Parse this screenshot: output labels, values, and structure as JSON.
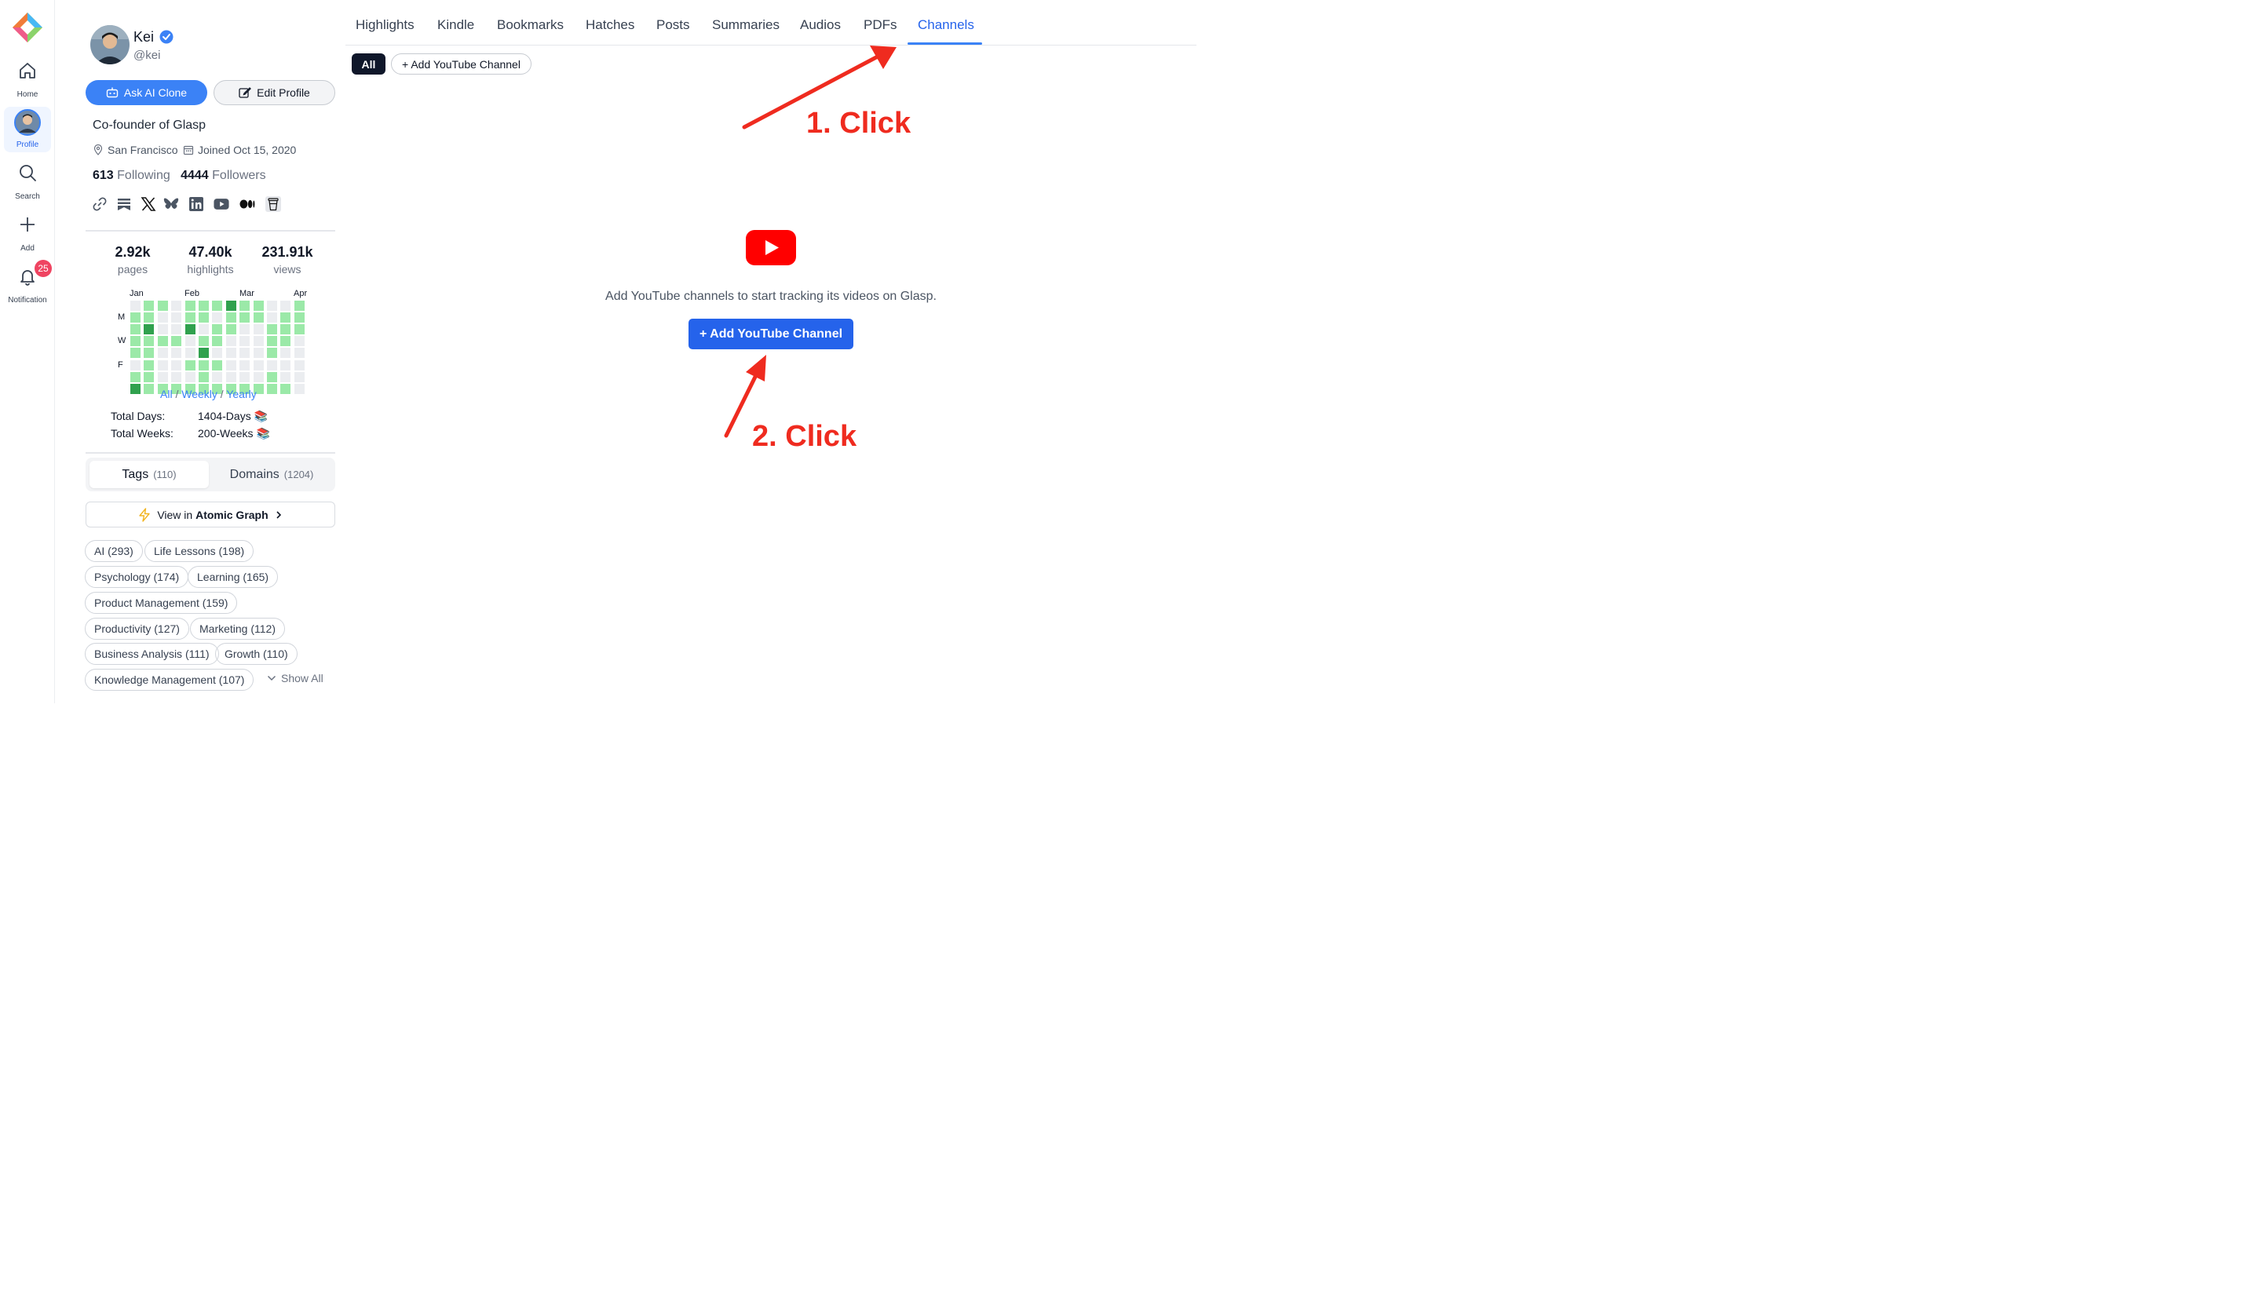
{
  "nav": {
    "items": [
      {
        "label": "Home",
        "icon": "home-icon"
      },
      {
        "label": "Profile",
        "icon": "avatar"
      },
      {
        "label": "Search",
        "icon": "search-icon"
      },
      {
        "label": "Add",
        "icon": "plus-icon"
      },
      {
        "label": "Notification",
        "icon": "bell-icon"
      }
    ],
    "notification_count": "25"
  },
  "profile": {
    "name": "Kei",
    "handle": "@kei",
    "ask_ai_label": "Ask AI Clone",
    "edit_label": "Edit Profile",
    "bio": "Co-founder of Glasp",
    "location": "San Francisco",
    "joined": "Joined Oct 15, 2020",
    "following_count": "613",
    "following_label": "Following",
    "followers_count": "4444",
    "followers_label": "Followers",
    "social_icons": [
      "link-icon",
      "bookmark-icon",
      "x-icon",
      "bluesky-icon",
      "linkedin-icon",
      "youtube-icon",
      "medium-icon",
      "coffee-icon"
    ]
  },
  "stats": [
    {
      "value": "2.92k",
      "label": "pages"
    },
    {
      "value": "47.40k",
      "label": "highlights"
    },
    {
      "value": "231.91k",
      "label": "views"
    }
  ],
  "heatmap": {
    "months": [
      "Jan",
      "Feb",
      "Mar",
      "Apr"
    ],
    "days": [
      "M",
      "W",
      "F"
    ],
    "colors": {
      "0": "#ebedf0",
      "1": "#9be9a8",
      "2": "#40c463",
      "3": "#30a14e"
    },
    "grid": [
      [
        0,
        1,
        1,
        0,
        1,
        1,
        1,
        3,
        1,
        1,
        0,
        0,
        1
      ],
      [
        1,
        1,
        0,
        0,
        1,
        1,
        0,
        1,
        1,
        1,
        0,
        1,
        1
      ],
      [
        1,
        3,
        0,
        0,
        3,
        0,
        1,
        1,
        0,
        0,
        1,
        1,
        1
      ],
      [
        1,
        1,
        1,
        1,
        0,
        1,
        1,
        0,
        0,
        0,
        1,
        1,
        0
      ],
      [
        1,
        1,
        0,
        0,
        0,
        3,
        0,
        0,
        0,
        0,
        1,
        0,
        0
      ],
      [
        0,
        1,
        0,
        0,
        1,
        1,
        1,
        0,
        0,
        0,
        0,
        0,
        0
      ],
      [
        1,
        1,
        0,
        0,
        0,
        1,
        0,
        0,
        0,
        0,
        1,
        0,
        0
      ],
      [
        3,
        1,
        1,
        1,
        1,
        1,
        1,
        1,
        1,
        1,
        1,
        1,
        0
      ]
    ]
  },
  "range_links": {
    "all": "All",
    "weekly": "Weekly",
    "yearly": "Yearly",
    "sep": "/"
  },
  "totals": {
    "days_label": "Total Days:",
    "days_value": "1404-Days 📚",
    "weeks_label": "Total Weeks:",
    "weeks_value": "200-Weeks 📚"
  },
  "tag_tabs": [
    {
      "label": "Tags",
      "count": "(110)"
    },
    {
      "label": "Domains",
      "count": "(1204)"
    }
  ],
  "atomic": {
    "prefix": "View in",
    "bold": "Atomic Graph"
  },
  "tags": [
    "AI (293)",
    "Life Lessons (198)",
    "Psychology (174)",
    "Learning (165)",
    "Product Management (159)",
    "Productivity (127)",
    "Marketing (112)",
    "Business Analysis (111)",
    "Growth (110)",
    "Knowledge Management (107)"
  ],
  "show_all": "Show All",
  "tabs": [
    "Highlights",
    "Kindle",
    "Bookmarks",
    "Hatches",
    "Posts",
    "Summaries",
    "Audios",
    "PDFs",
    "Channels"
  ],
  "filter": {
    "all": "All",
    "add_channel": "+ Add YouTube Channel"
  },
  "empty_state": {
    "message": "Add YouTube channels to start tracking its videos on Glasp.",
    "button": "+ Add YouTube Channel"
  },
  "annotations": {
    "step1": "1. Click",
    "step2": "2. Click",
    "color": "#ef2b1f"
  }
}
